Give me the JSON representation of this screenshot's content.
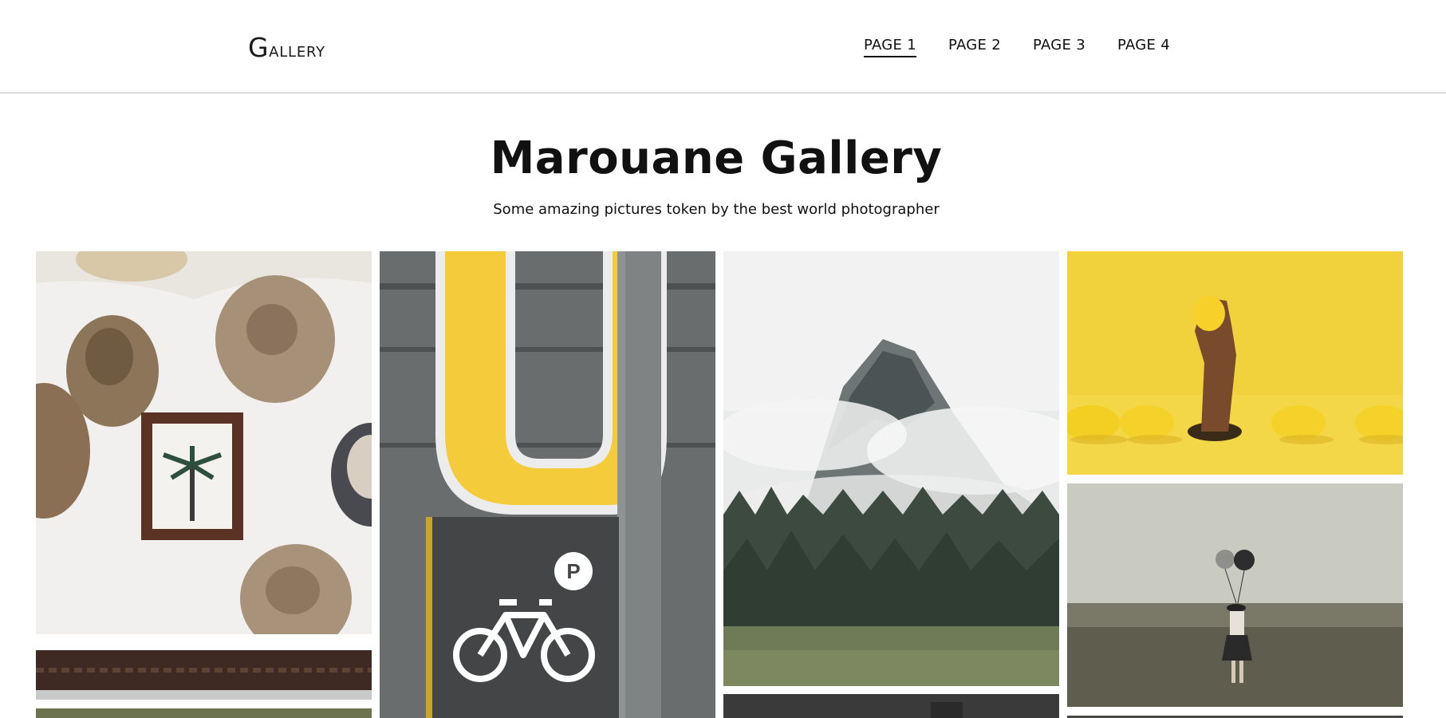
{
  "brand": {
    "initial": "G",
    "rest": "allery"
  },
  "nav": [
    {
      "label": "PAGE 1",
      "active": true
    },
    {
      "label": "PAGE 2",
      "active": false
    },
    {
      "label": "PAGE 3",
      "active": false
    },
    {
      "label": "PAGE 4",
      "active": false
    }
  ],
  "hero": {
    "title": "Marouane Gallery",
    "subtitle": "Some amazing pictures token by the best world photographer"
  },
  "gallery": {
    "photos": [
      {
        "subject": "straw hats and palm tree frame on white wall"
      },
      {
        "subject": "yellow U sign with bicycle parking sign"
      },
      {
        "subject": "misty mountain with pine forest"
      },
      {
        "subject": "hand holding lemon through yellow surface"
      },
      {
        "subject": "woman with balloons in foggy field"
      }
    ]
  }
}
